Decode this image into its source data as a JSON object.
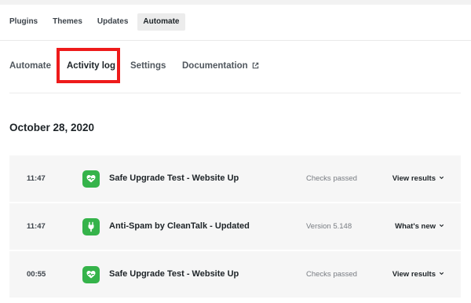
{
  "top_tabs": {
    "items": [
      {
        "label": "Plugins"
      },
      {
        "label": "Themes"
      },
      {
        "label": "Updates"
      },
      {
        "label": "Automate"
      }
    ],
    "active": "Automate"
  },
  "sub_tabs": {
    "items": [
      {
        "label": "Automate"
      },
      {
        "label": "Activity log"
      },
      {
        "label": "Settings"
      },
      {
        "label": "Documentation",
        "icon": "external-link-icon"
      }
    ],
    "active": "Activity log",
    "highlight_color": "#ee1b1b"
  },
  "log": {
    "date": "October 28, 2020",
    "icon_color": "#35b34a",
    "entries": [
      {
        "time": "11:47",
        "icon": "heartbeat-icon",
        "title": "Safe Upgrade Test - Website Up",
        "status": "Checks passed",
        "action": "View results"
      },
      {
        "time": "11:47",
        "icon": "plug-icon",
        "title": "Anti-Spam by CleanTalk - Updated",
        "status": "Version 5.148",
        "action": "What's new"
      },
      {
        "time": "00:55",
        "icon": "heartbeat-icon",
        "title": "Safe Upgrade Test - Website Up",
        "status": "Checks passed",
        "action": "View results"
      }
    ]
  }
}
